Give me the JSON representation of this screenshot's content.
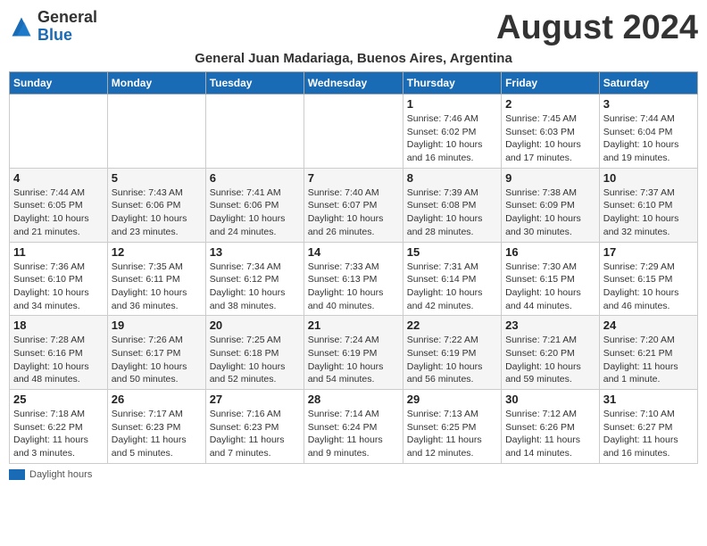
{
  "logo": {
    "general": "General",
    "blue": "Blue"
  },
  "title": "August 2024",
  "location": "General Juan Madariaga, Buenos Aires, Argentina",
  "days_of_week": [
    "Sunday",
    "Monday",
    "Tuesday",
    "Wednesday",
    "Thursday",
    "Friday",
    "Saturday"
  ],
  "weeks": [
    [
      {
        "day": "",
        "detail": ""
      },
      {
        "day": "",
        "detail": ""
      },
      {
        "day": "",
        "detail": ""
      },
      {
        "day": "",
        "detail": ""
      },
      {
        "day": "1",
        "detail": "Sunrise: 7:46 AM\nSunset: 6:02 PM\nDaylight: 10 hours\nand 16 minutes."
      },
      {
        "day": "2",
        "detail": "Sunrise: 7:45 AM\nSunset: 6:03 PM\nDaylight: 10 hours\nand 17 minutes."
      },
      {
        "day": "3",
        "detail": "Sunrise: 7:44 AM\nSunset: 6:04 PM\nDaylight: 10 hours\nand 19 minutes."
      }
    ],
    [
      {
        "day": "4",
        "detail": "Sunrise: 7:44 AM\nSunset: 6:05 PM\nDaylight: 10 hours\nand 21 minutes."
      },
      {
        "day": "5",
        "detail": "Sunrise: 7:43 AM\nSunset: 6:06 PM\nDaylight: 10 hours\nand 23 minutes."
      },
      {
        "day": "6",
        "detail": "Sunrise: 7:41 AM\nSunset: 6:06 PM\nDaylight: 10 hours\nand 24 minutes."
      },
      {
        "day": "7",
        "detail": "Sunrise: 7:40 AM\nSunset: 6:07 PM\nDaylight: 10 hours\nand 26 minutes."
      },
      {
        "day": "8",
        "detail": "Sunrise: 7:39 AM\nSunset: 6:08 PM\nDaylight: 10 hours\nand 28 minutes."
      },
      {
        "day": "9",
        "detail": "Sunrise: 7:38 AM\nSunset: 6:09 PM\nDaylight: 10 hours\nand 30 minutes."
      },
      {
        "day": "10",
        "detail": "Sunrise: 7:37 AM\nSunset: 6:10 PM\nDaylight: 10 hours\nand 32 minutes."
      }
    ],
    [
      {
        "day": "11",
        "detail": "Sunrise: 7:36 AM\nSunset: 6:10 PM\nDaylight: 10 hours\nand 34 minutes."
      },
      {
        "day": "12",
        "detail": "Sunrise: 7:35 AM\nSunset: 6:11 PM\nDaylight: 10 hours\nand 36 minutes."
      },
      {
        "day": "13",
        "detail": "Sunrise: 7:34 AM\nSunset: 6:12 PM\nDaylight: 10 hours\nand 38 minutes."
      },
      {
        "day": "14",
        "detail": "Sunrise: 7:33 AM\nSunset: 6:13 PM\nDaylight: 10 hours\nand 40 minutes."
      },
      {
        "day": "15",
        "detail": "Sunrise: 7:31 AM\nSunset: 6:14 PM\nDaylight: 10 hours\nand 42 minutes."
      },
      {
        "day": "16",
        "detail": "Sunrise: 7:30 AM\nSunset: 6:15 PM\nDaylight: 10 hours\nand 44 minutes."
      },
      {
        "day": "17",
        "detail": "Sunrise: 7:29 AM\nSunset: 6:15 PM\nDaylight: 10 hours\nand 46 minutes."
      }
    ],
    [
      {
        "day": "18",
        "detail": "Sunrise: 7:28 AM\nSunset: 6:16 PM\nDaylight: 10 hours\nand 48 minutes."
      },
      {
        "day": "19",
        "detail": "Sunrise: 7:26 AM\nSunset: 6:17 PM\nDaylight: 10 hours\nand 50 minutes."
      },
      {
        "day": "20",
        "detail": "Sunrise: 7:25 AM\nSunset: 6:18 PM\nDaylight: 10 hours\nand 52 minutes."
      },
      {
        "day": "21",
        "detail": "Sunrise: 7:24 AM\nSunset: 6:19 PM\nDaylight: 10 hours\nand 54 minutes."
      },
      {
        "day": "22",
        "detail": "Sunrise: 7:22 AM\nSunset: 6:19 PM\nDaylight: 10 hours\nand 56 minutes."
      },
      {
        "day": "23",
        "detail": "Sunrise: 7:21 AM\nSunset: 6:20 PM\nDaylight: 10 hours\nand 59 minutes."
      },
      {
        "day": "24",
        "detail": "Sunrise: 7:20 AM\nSunset: 6:21 PM\nDaylight: 11 hours\nand 1 minute."
      }
    ],
    [
      {
        "day": "25",
        "detail": "Sunrise: 7:18 AM\nSunset: 6:22 PM\nDaylight: 11 hours\nand 3 minutes."
      },
      {
        "day": "26",
        "detail": "Sunrise: 7:17 AM\nSunset: 6:23 PM\nDaylight: 11 hours\nand 5 minutes."
      },
      {
        "day": "27",
        "detail": "Sunrise: 7:16 AM\nSunset: 6:23 PM\nDaylight: 11 hours\nand 7 minutes."
      },
      {
        "day": "28",
        "detail": "Sunrise: 7:14 AM\nSunset: 6:24 PM\nDaylight: 11 hours\nand 9 minutes."
      },
      {
        "day": "29",
        "detail": "Sunrise: 7:13 AM\nSunset: 6:25 PM\nDaylight: 11 hours\nand 12 minutes."
      },
      {
        "day": "30",
        "detail": "Sunrise: 7:12 AM\nSunset: 6:26 PM\nDaylight: 11 hours\nand 14 minutes."
      },
      {
        "day": "31",
        "detail": "Sunrise: 7:10 AM\nSunset: 6:27 PM\nDaylight: 11 hours\nand 16 minutes."
      }
    ]
  ],
  "footer": {
    "daylight_label": "Daylight hours"
  }
}
